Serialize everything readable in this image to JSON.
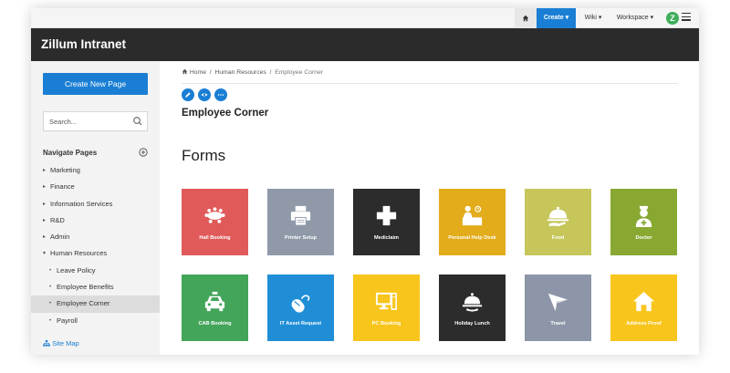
{
  "topnav": {
    "create_label": "Create",
    "wiki_label": "Wiki",
    "workspace_label": "Workspace",
    "avatar_letter": "Z"
  },
  "header": {
    "brand": "Zillum Intranet"
  },
  "sidebar": {
    "create_button": "Create New Page",
    "search_placeholder": "Search...",
    "nav_title": "Navigate Pages",
    "items": [
      {
        "label": "Marketing"
      },
      {
        "label": "Finance"
      },
      {
        "label": "Information Services"
      },
      {
        "label": "R&D"
      },
      {
        "label": "Admin"
      },
      {
        "label": "Human Resources"
      },
      {
        "label": "Leave Policy"
      },
      {
        "label": "Employee Benefits"
      },
      {
        "label": "Employee Corner"
      },
      {
        "label": "Payroll"
      }
    ],
    "sitemap": "Site Map"
  },
  "breadcrumb": {
    "home": "Home",
    "parent": "Human Resources",
    "current": "Employee Corner"
  },
  "page_title": "Employee Corner",
  "section_title": "Forms",
  "tiles": [
    {
      "label": "Hall Booking",
      "icon": "meeting-icon",
      "color": "#e05a5a"
    },
    {
      "label": "Printer Setup",
      "icon": "printer-icon",
      "color": "#8f99a8"
    },
    {
      "label": "Mediclaim",
      "icon": "medical-cross-icon",
      "color": "#2c2c2c"
    },
    {
      "label": "Personal Help Desk",
      "icon": "help-desk-icon",
      "color": "#e2ac1b"
    },
    {
      "label": "Food",
      "icon": "food-cloche-icon",
      "color": "#c6c65b"
    },
    {
      "label": "Doctor",
      "icon": "nurse-icon",
      "color": "#88a832"
    },
    {
      "label": "CAB Booking",
      "icon": "taxi-icon",
      "color": "#43a55a"
    },
    {
      "label": "IT Asset Request",
      "icon": "mouse-icon",
      "color": "#1f8ed7"
    },
    {
      "label": "PC Booking",
      "icon": "computer-icon",
      "color": "#f7c51b"
    },
    {
      "label": "Holiday Lunch",
      "icon": "serving-tray-icon",
      "color": "#2c2c2c"
    },
    {
      "label": "Travel",
      "icon": "paper-plane-icon",
      "color": "#8d96a8"
    },
    {
      "label": "Address Proof",
      "icon": "house-icon",
      "color": "#f8c51c"
    }
  ]
}
